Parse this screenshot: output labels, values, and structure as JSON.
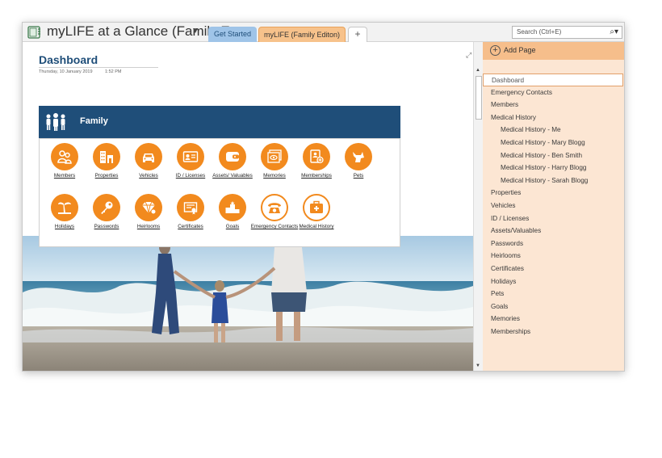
{
  "window": {
    "notebook_title": "myLIFE at a Glance (Family E...",
    "dropdown_glyph": "▼"
  },
  "tabs": [
    {
      "label": "Get Started"
    },
    {
      "label": "myLIFE (Family Editon)"
    },
    {
      "label": "+"
    }
  ],
  "search": {
    "placeholder": "Search (Ctrl+E)",
    "icon": "search-icon"
  },
  "page": {
    "title": "Dashboard",
    "date": "Thursday, 10 January 2019",
    "time": "1:52 PM"
  },
  "family_section": {
    "label": "Family"
  },
  "tiles": [
    {
      "label": "Members",
      "icon": "people-icon"
    },
    {
      "label": "Properties",
      "icon": "buildings-icon"
    },
    {
      "label": "Vehicles",
      "icon": "car-icon"
    },
    {
      "label": "ID / Licenses",
      "icon": "id-card-icon"
    },
    {
      "label": "Assets/ Valuables",
      "icon": "wallet-icon"
    },
    {
      "label": "Memories",
      "icon": "photos-icon"
    },
    {
      "label": "Memberships",
      "icon": "membership-icon"
    },
    {
      "label": "Pets",
      "icon": "dog-icon"
    },
    {
      "label": "Holidays",
      "icon": "beach-icon"
    },
    {
      "label": "Passwords",
      "icon": "key-icon"
    },
    {
      "label": "Heirlooms",
      "icon": "diamond-icon"
    },
    {
      "label": "Certificates",
      "icon": "certificate-icon"
    },
    {
      "label": "Goals",
      "icon": "podium-icon"
    },
    {
      "label": "Emergency Contacts",
      "icon": "phone-icon"
    },
    {
      "label": "Medical History",
      "icon": "medical-kit-icon"
    }
  ],
  "sidebar": {
    "add_page_label": "Add Page",
    "pages": [
      {
        "label": "Dashboard",
        "level": 0,
        "selected": true
      },
      {
        "label": "Emergency Contacts",
        "level": 0
      },
      {
        "label": "Members",
        "level": 0
      },
      {
        "label": "Medical History",
        "level": 0
      },
      {
        "label": "Medical History - Me",
        "level": 1
      },
      {
        "label": "Medical History - Mary Blogg",
        "level": 1
      },
      {
        "label": "Medical History - Ben Smith",
        "level": 1
      },
      {
        "label": "Medical History - Harry Blogg",
        "level": 1
      },
      {
        "label": "Medical History - Sarah Blogg",
        "level": 1
      },
      {
        "label": "Properties",
        "level": 0
      },
      {
        "label": "Vehicles",
        "level": 0
      },
      {
        "label": "ID / Licenses",
        "level": 0
      },
      {
        "label": "Assets/Valuables",
        "level": 0
      },
      {
        "label": "Passwords",
        "level": 0
      },
      {
        "label": "Heirlooms",
        "level": 0
      },
      {
        "label": "Certificates",
        "level": 0
      },
      {
        "label": "Holidays",
        "level": 0
      },
      {
        "label": "Pets",
        "level": 0
      },
      {
        "label": "Goals",
        "level": 0
      },
      {
        "label": "Memories",
        "level": 0
      },
      {
        "label": "Memberships",
        "level": 0
      }
    ]
  },
  "colors": {
    "accent_orange": "#f28a1e",
    "banner_navy": "#1f4e79",
    "sidebar_bg": "#fce6d3",
    "add_page_bg": "#f6be8b"
  }
}
